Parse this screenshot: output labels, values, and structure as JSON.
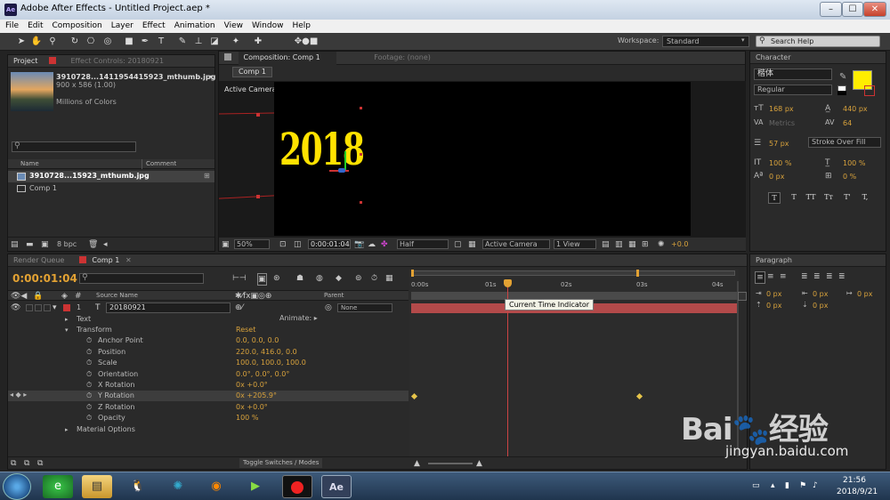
{
  "window": {
    "title": "Adobe After Effects - Untitled Project.aep *",
    "app_icon": "Ae",
    "min": "–",
    "max": "☐",
    "close": "✕"
  },
  "menu": [
    "File",
    "Edit",
    "Composition",
    "Layer",
    "Effect",
    "Animation",
    "View",
    "Window",
    "Help"
  ],
  "workspace": {
    "label": "Workspace:",
    "value": "Standard",
    "search_placeholder": "Search Help"
  },
  "project": {
    "tab": "Project",
    "effect_tab": "Effect Controls: 20180921",
    "file": "3910728...1411954415923_mthumb.jpg",
    "dims": "900 x 586 (1.00)",
    "colors": "Millions of Colors",
    "col_name": "Name",
    "col_comment": "Comment",
    "items": [
      {
        "name": "3910728...15923_mthumb.jpg"
      },
      {
        "name": "Comp 1"
      }
    ],
    "bpc": "8 bpc"
  },
  "viewer": {
    "comp_tab": "Composition: Comp 1",
    "footage_tab": "Footage: (none)",
    "comp_button": "Comp 1",
    "camera_label": "Active Camera",
    "comp_text": "2018",
    "zoom": "50%",
    "timecode": "0:00:01:04",
    "resolution": "Half",
    "camera": "Active Camera",
    "views": "1 View",
    "exposure": "+0.0"
  },
  "character": {
    "tab": "Character",
    "font": "楷体",
    "style": "Regular",
    "size": "168 px",
    "leading": "440 px",
    "kerning": "Metrics",
    "tracking": "64",
    "stroke": "57 px",
    "stroke_mode": "Stroke Over Fill",
    "vscale": "100 %",
    "hscale": "100 %",
    "baseline": "0 px",
    "tsume": "0 %",
    "fill_color": "#ffee00",
    "styles": [
      "T",
      "T",
      "TT",
      "Tт",
      "T'",
      "T,"
    ]
  },
  "paragraph": {
    "tab": "Paragraph",
    "v1": "0 px",
    "v2": "0 px",
    "v3": "0 px",
    "v4": "0 px",
    "v5": "0 px"
  },
  "timeline": {
    "render_tab": "Render Queue",
    "comp_tab": "Comp 1",
    "timecode": "0:00:01:04",
    "col_source": "Source Name",
    "col_parent": "Parent",
    "layer_num": "1",
    "layer_name": "20180921",
    "parent_value": "None",
    "animate": "Animate:",
    "toggle": "Toggle Switches / Modes",
    "tooltip": "Current Time Indicator",
    "ruler": [
      "0:00s",
      "01s",
      "02s",
      "03s",
      "04s"
    ],
    "props": [
      {
        "name": "Text",
        "value": ""
      },
      {
        "name": "Transform",
        "value": "Reset"
      },
      {
        "name": "Anchor Point",
        "value": "0.0, 0.0, 0.0"
      },
      {
        "name": "Position",
        "value": "220.0, 416.0, 0.0"
      },
      {
        "name": "Scale",
        "value": "100.0, 100.0, 100.0"
      },
      {
        "name": "Orientation",
        "value": "0.0°, 0.0°, 0.0°"
      },
      {
        "name": "X Rotation",
        "value": "0x +0.0°"
      },
      {
        "name": "Y Rotation",
        "value": "0x +205.9°"
      },
      {
        "name": "Z Rotation",
        "value": "0x +0.0°"
      },
      {
        "name": "Opacity",
        "value": "100 %"
      },
      {
        "name": "Material Options",
        "value": ""
      }
    ]
  },
  "taskbar": {
    "time": "21:56",
    "date": "2018/9/21",
    "items": [
      "ie",
      "folder",
      "qq",
      "media",
      "firefox",
      "video",
      "record",
      "ae"
    ]
  },
  "watermark": {
    "text": "Bai du 经验",
    "url": "jingyan.baidu.com"
  },
  "colors": {
    "accent": "#e3a233",
    "layer_bar": "#b34a4a",
    "ctI": "#cc4444",
    "comp_bg": "#000000"
  }
}
